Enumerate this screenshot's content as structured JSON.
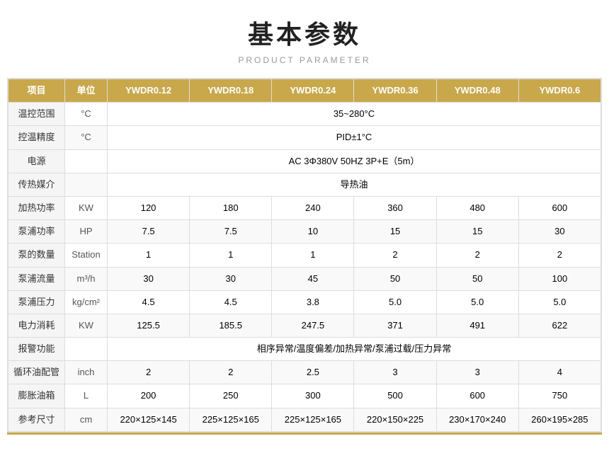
{
  "header": {
    "title": "基本参数",
    "subtitle": "PRODUCT PARAMETER"
  },
  "table": {
    "columns": [
      "项目",
      "单位",
      "YWDR0.12",
      "YWDR0.18",
      "YWDR0.24",
      "YWDR0.36",
      "YWDR0.48",
      "YWDR0.6"
    ],
    "rows": [
      {
        "label": "温控范围",
        "unit": "°C",
        "span": true,
        "spanValue": "35~280°C"
      },
      {
        "label": "控温精度",
        "unit": "°C",
        "span": true,
        "spanValue": "PID±1°C"
      },
      {
        "label": "电源",
        "unit": "",
        "span": true,
        "spanValue": "AC 3Φ380V 50HZ 3P+E（5m）"
      },
      {
        "label": "传热媒介",
        "unit": "",
        "span": true,
        "spanValue": "导热油"
      },
      {
        "label": "加热功率",
        "unit": "KW",
        "span": false,
        "values": [
          "120",
          "180",
          "240",
          "360",
          "480",
          "600"
        ]
      },
      {
        "label": "泵浦功率",
        "unit": "HP",
        "span": false,
        "values": [
          "7.5",
          "7.5",
          "10",
          "15",
          "15",
          "30"
        ]
      },
      {
        "label": "泵的数量",
        "unit": "Station",
        "span": false,
        "values": [
          "1",
          "1",
          "1",
          "2",
          "2",
          "2"
        ]
      },
      {
        "label": "泵浦流量",
        "unit": "m³/h",
        "span": false,
        "values": [
          "30",
          "30",
          "45",
          "50",
          "50",
          "100"
        ]
      },
      {
        "label": "泵浦压力",
        "unit": "kg/cm²",
        "span": false,
        "values": [
          "4.5",
          "4.5",
          "3.8",
          "5.0",
          "5.0",
          "5.0"
        ]
      },
      {
        "label": "电力消耗",
        "unit": "KW",
        "span": false,
        "values": [
          "125.5",
          "185.5",
          "247.5",
          "371",
          "491",
          "622"
        ]
      },
      {
        "label": "报警功能",
        "unit": "",
        "span": true,
        "spanValue": "相序异常/温度偏差/加热异常/泵浦过载/压力异常"
      },
      {
        "label": "循环油配管",
        "unit": "inch",
        "span": false,
        "values": [
          "2",
          "2",
          "2.5",
          "3",
          "3",
          "4"
        ]
      },
      {
        "label": "膨胀油箱",
        "unit": "L",
        "span": false,
        "values": [
          "200",
          "250",
          "300",
          "500",
          "600",
          "750"
        ]
      },
      {
        "label": "参考尺寸",
        "unit": "cm",
        "span": false,
        "values": [
          "220×125×145",
          "225×125×165",
          "225×125×165",
          "220×150×225",
          "230×170×240",
          "260×195×285"
        ]
      }
    ]
  }
}
